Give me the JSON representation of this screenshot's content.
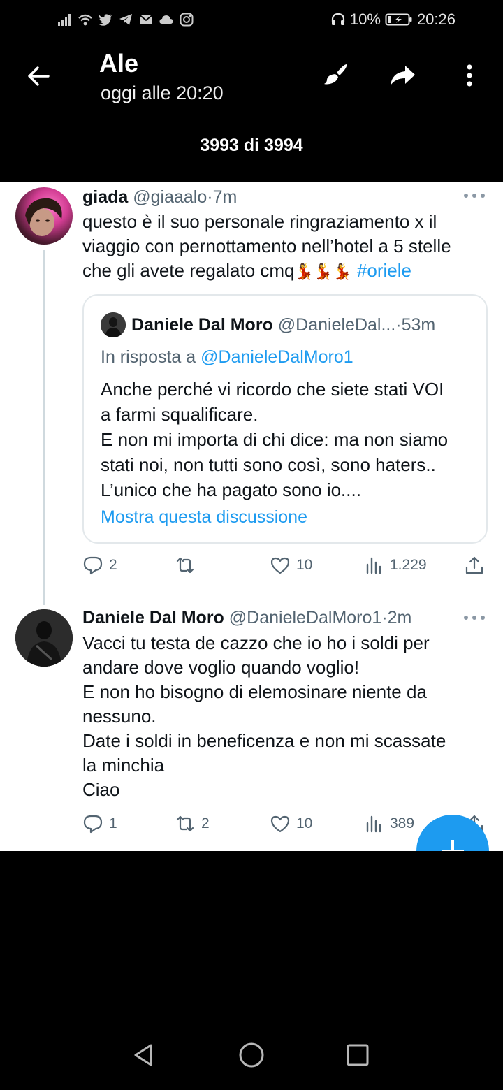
{
  "status_bar": {
    "battery": "10%",
    "time": "20:26",
    "left_icons": [
      "signal-icon",
      "wifi-icon",
      "twitter-icon",
      "telegram-icon",
      "mail-icon",
      "cloud-icon",
      "instagram-icon"
    ],
    "right_icons": [
      "headset-icon",
      "battery-icon"
    ]
  },
  "header": {
    "title": "Ale",
    "subtitle": "oggi alle 20:20",
    "counter": "3993 di 3994",
    "icons": [
      "back-arrow-icon",
      "edit-brush-icon",
      "share-icon",
      "more-vert-icon"
    ]
  },
  "tweets": [
    {
      "name": "giada",
      "handle": "@giaaalo",
      "time": "7m",
      "text_line1": "questo è il suo personale ringraziamento x il",
      "text_line2": "viaggio con pernottamento nell’hotel a 5 stelle",
      "text_line3": "che gli avete regalato cmq",
      "emojis": "💃💃💃",
      "hashtag": "#oriele",
      "quote": {
        "name": "Daniele Dal Moro",
        "handle": "@DanieleDal...",
        "time": "53m",
        "reply_prefix": "In risposta a",
        "reply_mention": "@DanieleDalMoro1",
        "lines": [
          "Anche perché vi ricordo che siete stati VOI",
          "a farmi squalificare.",
          "E non mi importa di chi dice: ma non siamo",
          "stati noi, non tutti sono così, sono haters..",
          "L’unico che ha pagato sono io...."
        ],
        "show_thread": "Mostra questa discussione"
      },
      "actions": {
        "replies": "2",
        "retweets": "",
        "likes": "10",
        "views": "1.229"
      }
    },
    {
      "name": "Daniele Dal Moro",
      "handle": "@DanieleDalMoro1",
      "time": "2m",
      "lines": [
        "Vacci tu testa de cazzo che io ho i soldi per",
        "andare dove voglio quando voglio!",
        "E non ho bisogno di elemosinare niente da",
        "nessuno.",
        "Date i soldi in beneficenza e non mi scassate",
        "la minchia",
        "Ciao"
      ],
      "actions": {
        "replies": "1",
        "retweets": "2",
        "likes": "10",
        "views": "389"
      }
    }
  ],
  "colors": {
    "accent": "#1d9bf0",
    "muted": "#536471",
    "text": "#0f1419"
  }
}
